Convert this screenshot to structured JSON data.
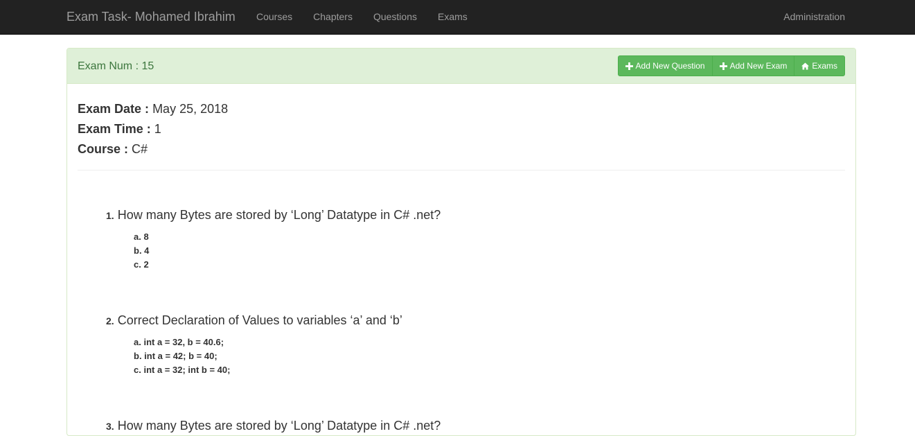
{
  "navbar": {
    "brand": "Exam Task- Mohamed Ibrahim",
    "links": [
      "Courses",
      "Chapters",
      "Questions",
      "Exams"
    ],
    "right_link": "Administration"
  },
  "panel": {
    "title": "Exam Num : 15",
    "buttons": {
      "add_question": "Add New Question",
      "add_exam": "Add New Exam",
      "exams": "Exams"
    },
    "meta": {
      "date_label": "Exam Date :",
      "date_value": "May 25, 2018",
      "time_label": "Exam Time :",
      "time_value": "1",
      "course_label": "Course :",
      "course_value": "C#"
    }
  },
  "questions": [
    {
      "number": "1.",
      "text": "How many Bytes are stored by ‘Long’ Datatype in C# .net?",
      "answers": [
        "a. 8",
        "b. 4",
        "c. 2"
      ]
    },
    {
      "number": "2.",
      "text": "Correct Declaration of Values to variables ‘a’ and ‘b’",
      "answers": [
        "a. int a = 32, b = 40.6;",
        "b. int a = 42; b = 40;",
        "c. int a = 32; int b = 40;"
      ]
    },
    {
      "number": "3.",
      "text": "How many Bytes are stored by ‘Long’ Datatype in C# .net?",
      "answers": []
    }
  ],
  "colors": {
    "navbar_bg": "#222222",
    "nav_text": "#9d9d9d",
    "panel_heading_bg": "#dff0d8",
    "panel_title": "#3c763d",
    "button_bg": "#5cb85c"
  },
  "icons": {
    "add_question": "plus-icon",
    "add_exam": "plus-icon",
    "exams": "home-icon"
  }
}
